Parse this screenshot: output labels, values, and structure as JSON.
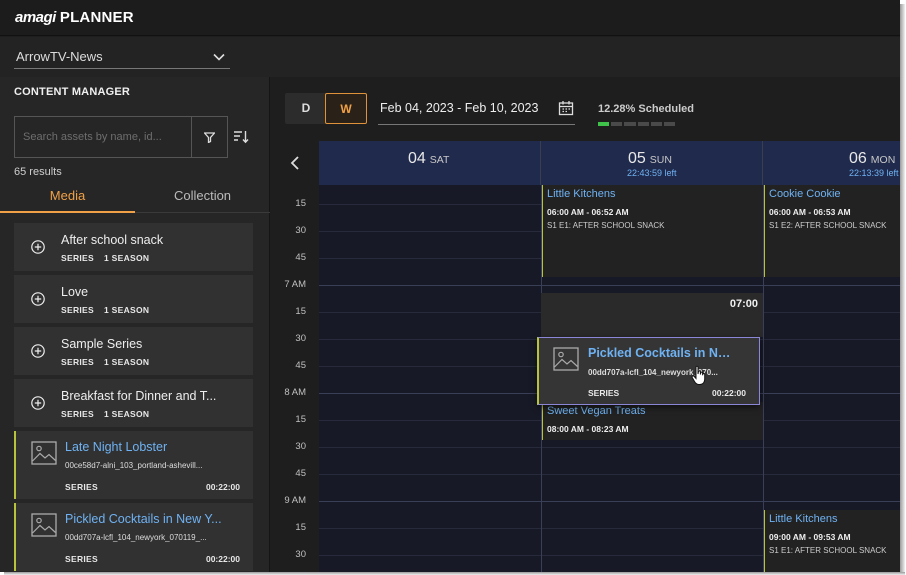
{
  "app": {
    "logo_brand": "amagi",
    "logo_product": "PLANNER"
  },
  "channel": {
    "selected": "ArrowTV-News"
  },
  "content_manager": {
    "title": "CONTENT MANAGER",
    "search_placeholder": "Search assets by name, id...",
    "results": "65 results",
    "tabs": [
      {
        "label": "Media",
        "active": true
      },
      {
        "label": "Collection",
        "active": false
      }
    ],
    "series": [
      {
        "name": "After school snack",
        "type": "SERIES",
        "seasons": "1 SEASON"
      },
      {
        "name": "Love",
        "type": "SERIES",
        "seasons": "1 SEASON"
      },
      {
        "name": "Sample Series",
        "type": "SERIES",
        "seasons": "1 SEASON"
      },
      {
        "name": "Breakfast for Dinner and T...",
        "type": "SERIES",
        "seasons": "1 SEASON"
      }
    ],
    "assets": [
      {
        "name": "Late Night Lobster",
        "id": "00ce58d7-alni_103_portland-ashevill...",
        "type": "SERIES",
        "duration": "00:22:00"
      },
      {
        "name": "Pickled Cocktails in New Y...",
        "id": "00dd707a-lcfl_104_newyork_070119_...",
        "type": "SERIES",
        "duration": "00:22:00"
      }
    ]
  },
  "scheduler": {
    "view_day": "D",
    "view_week": "W",
    "date_range": "Feb 04, 2023 - Feb 10, 2023",
    "scheduled_pct": "12.28% Scheduled",
    "scheduled_fraction": 0.1228,
    "days": [
      {
        "num": "04",
        "dow": "SAT",
        "left": ""
      },
      {
        "num": "05",
        "dow": "SUN",
        "left": "22:43:59 left"
      },
      {
        "num": "06",
        "dow": "MON",
        "left": "22:13:39 left"
      }
    ],
    "time_labels": [
      "15",
      "30",
      "45",
      "7 AM",
      "15",
      "30",
      "45",
      "8 AM",
      "15",
      "30",
      "45",
      "9 AM",
      "15",
      "30"
    ],
    "events": [
      {
        "title": "Little Kitchens",
        "time": "06:00 AM - 06:52 AM",
        "desc": "S1 E1: AFTER SCHOOL SNACK"
      },
      {
        "title": "Cookie Cookie",
        "time": "06:00 AM - 06:53 AM",
        "desc": "S1 E2: AFTER SCHOOL SNACK"
      },
      {
        "title": "Sweet Vegan Treats",
        "time": "08:00 AM - 08:23 AM",
        "desc": ""
      },
      {
        "title": "Little Kitchens",
        "time": "09:00 AM - 09:53 AM",
        "desc": "S1 E1: AFTER SCHOOL SNACK"
      }
    ],
    "gap_label": "07:00",
    "drag_item": {
      "name": "Pickled Cocktails in Ne...",
      "id": "00dd707a-lcfl_104_newyork_070...",
      "type": "SERIES",
      "duration": "00:22:00"
    }
  },
  "colors": {
    "accent": "#f0a046",
    "link": "#6fb2f3",
    "event_border": "#b7c33b",
    "day_header": "#202a4c",
    "progress": "#3ec24a"
  },
  "icons": [
    "chevron-down-icon",
    "filter-icon",
    "sort-icon",
    "plus-circle-icon",
    "image-placeholder-icon",
    "calendar-icon",
    "chevron-left-icon",
    "cursor-icon"
  ]
}
